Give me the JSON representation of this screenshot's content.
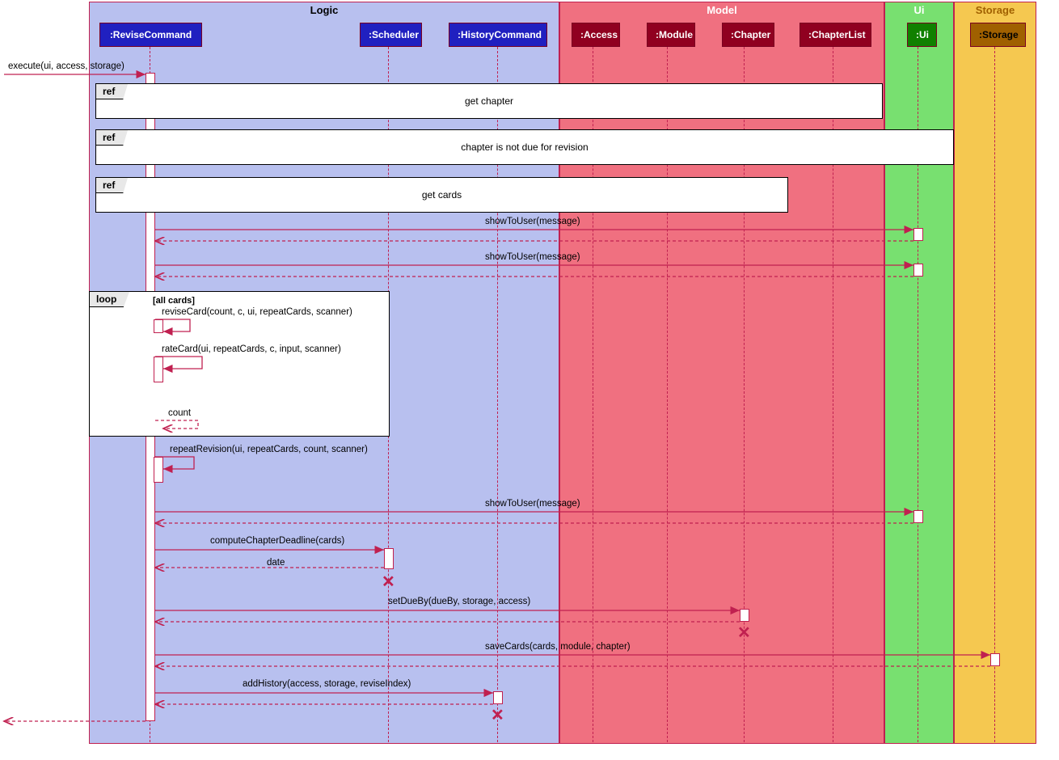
{
  "packages": {
    "logic": "Logic",
    "model": "Model",
    "ui": "Ui",
    "storage": "Storage"
  },
  "participants": {
    "revise": ":ReviseCommand",
    "scheduler": ":Scheduler",
    "history": ":HistoryCommand",
    "access": ":Access",
    "module": ":Module",
    "chapter": ":Chapter",
    "chapterlist": ":ChapterList",
    "ui": ":Ui",
    "storage": ":Storage"
  },
  "lifeline_x": {
    "revise": 185,
    "scheduler": 480,
    "history": 615,
    "access": 733,
    "module": 825,
    "chapter": 920,
    "chapterlist": 1030,
    "ui": 1135,
    "storage": 1230
  },
  "external_call": "execute(ui, access, storage)",
  "refs": {
    "ref_tab": "ref",
    "r1": "get chapter",
    "r2": "chapter is not due for revision",
    "r3": "get cards"
  },
  "messages": {
    "m1": "showToUser(message)",
    "m2": "showToUser(message)",
    "m3": "reviseCard(count, c, ui, repeatCards, scanner)",
    "m4": "rateCard(ui, repeatCards, c, input, scanner)",
    "m5": "count",
    "m6": "repeatRevision(ui, repeatCards, count, scanner)",
    "m7": "showToUser(message)",
    "m8": "computeChapterDeadline(cards)",
    "m9": "date",
    "m10": "setDueBy(dueBy, storage, access)",
    "m11": "saveCards(cards, module, chapter)",
    "m12": "addHistory(access, storage, reviseIndex)"
  },
  "loop": {
    "tab": "loop",
    "guard": "[all cards]"
  },
  "diagram_meta": {
    "type": "UML sequence diagram",
    "colors": {
      "logic_bg": "#b8c0ef",
      "model_bg": "#f07080",
      "ui_bg": "#78e070",
      "storage_bg": "#f5c850",
      "arrow": "#c02050"
    }
  }
}
